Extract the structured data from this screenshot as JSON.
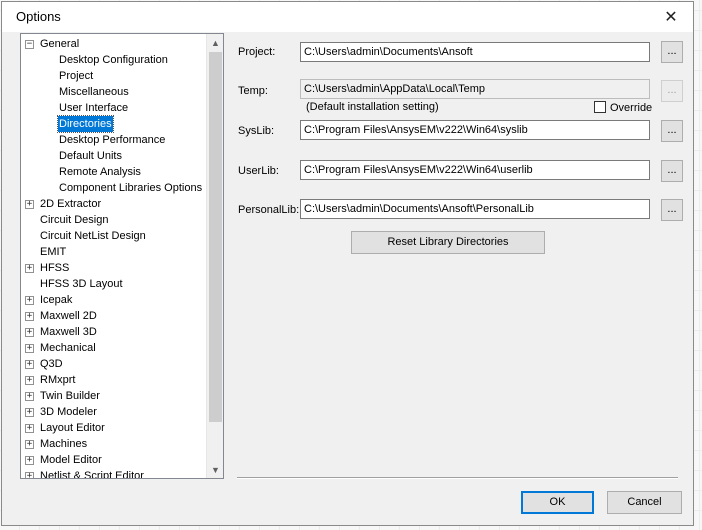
{
  "window": {
    "title": "Options",
    "close_glyph": "✕"
  },
  "tree": {
    "items": [
      {
        "label": "General",
        "expander": "−"
      },
      {
        "label": "Desktop Configuration"
      },
      {
        "label": "Project"
      },
      {
        "label": "Miscellaneous"
      },
      {
        "label": "User Interface"
      },
      {
        "label": "Directories",
        "selected": true
      },
      {
        "label": "Desktop Performance"
      },
      {
        "label": "Default Units"
      },
      {
        "label": "Remote Analysis"
      },
      {
        "label": "Component Libraries Options"
      },
      {
        "label": "2D Extractor",
        "expander": "+"
      },
      {
        "label": "Circuit Design"
      },
      {
        "label": "Circuit NetList Design"
      },
      {
        "label": "EMIT"
      },
      {
        "label": "HFSS",
        "expander": "+"
      },
      {
        "label": "HFSS 3D Layout"
      },
      {
        "label": "Icepak",
        "expander": "+"
      },
      {
        "label": "Maxwell 2D",
        "expander": "+"
      },
      {
        "label": "Maxwell 3D",
        "expander": "+"
      },
      {
        "label": "Mechanical",
        "expander": "+"
      },
      {
        "label": "Q3D",
        "expander": "+"
      },
      {
        "label": "RMxprt",
        "expander": "+"
      },
      {
        "label": "Twin Builder",
        "expander": "+"
      },
      {
        "label": "3D Modeler",
        "expander": "+"
      },
      {
        "label": "Layout Editor",
        "expander": "+"
      },
      {
        "label": "Machines",
        "expander": "+"
      },
      {
        "label": "Model Editor",
        "expander": "+"
      },
      {
        "label": "Netlist & Script Editor",
        "expander": "+"
      }
    ],
    "scroll_up": "▲",
    "scroll_down": "▼"
  },
  "fields": {
    "project": {
      "label": "Project:",
      "value": "C:\\Users\\admin\\Documents\\Ansoft",
      "browse": "..."
    },
    "temp": {
      "label": "Temp:",
      "value": "C:\\Users\\admin\\AppData\\Local\\Temp",
      "browse": "...",
      "note": "(Default installation setting)",
      "override_label": "Override"
    },
    "syslib": {
      "label": "SysLib:",
      "value": "C:\\Program Files\\AnsysEM\\v222\\Win64\\syslib",
      "browse": "..."
    },
    "userlib": {
      "label": "UserLib:",
      "value": "C:\\Program Files\\AnsysEM\\v222\\Win64\\userlib",
      "browse": "..."
    },
    "personallib": {
      "label": "PersonalLib:",
      "value": "C:\\Users\\admin\\Documents\\Ansoft\\PersonalLib",
      "browse": "..."
    }
  },
  "buttons": {
    "reset": "Reset Library Directories",
    "ok": "OK",
    "cancel": "Cancel"
  },
  "colors": {
    "selection": "#0078d7",
    "dialog_bg": "#f0f0f0"
  }
}
